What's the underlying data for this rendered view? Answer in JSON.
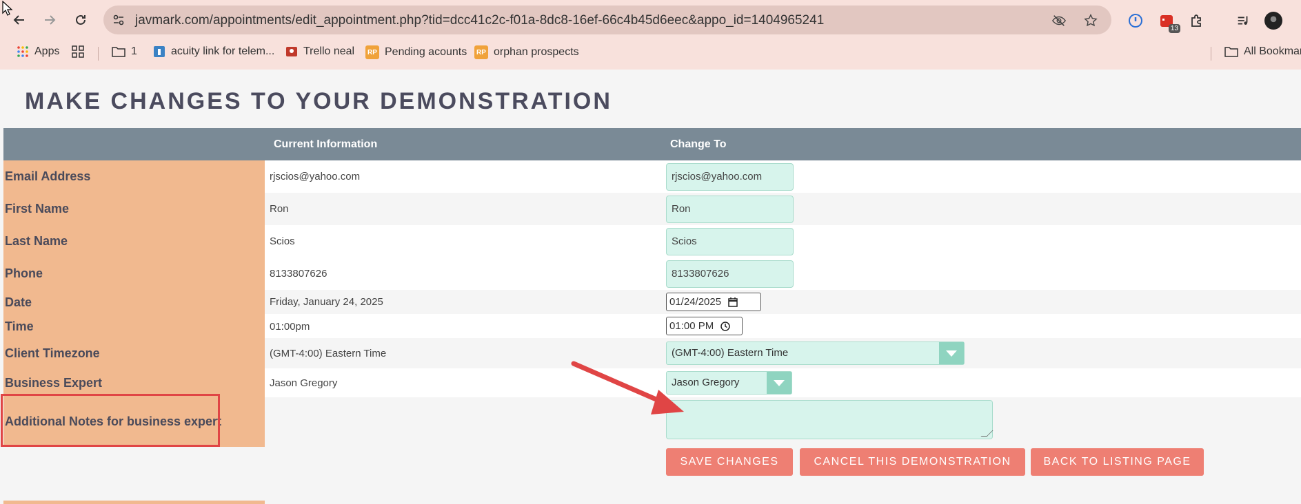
{
  "browser": {
    "url": "javmark.com/appointments/edit_appointment.php?tid=dcc41c2c-f01a-8dc8-16ef-66c4b45d6eec&appo_id=1404965241",
    "extension_badge": "13",
    "bookmarks": {
      "apps": "Apps",
      "folder_1": "1",
      "acuity": "acuity link for telem...",
      "trello": "Trello neal",
      "pending": "Pending acounts",
      "orphan": "orphan prospects",
      "all_bookmarks": "All Bookmar"
    },
    "rp_badge": "RP"
  },
  "page": {
    "title": "MAKE CHANGES TO YOUR DEMONSTRATION"
  },
  "table": {
    "headers": {
      "current": "Current Information",
      "change_to": "Change To"
    },
    "rows": {
      "email": {
        "label": "Email Address",
        "current": "rjscios@yahoo.com",
        "value": "rjscios@yahoo.com"
      },
      "first_name": {
        "label": "First Name",
        "current": "Ron",
        "value": "Ron"
      },
      "last_name": {
        "label": "Last Name",
        "current": "Scios",
        "value": "Scios"
      },
      "phone": {
        "label": "Phone",
        "current": "8133807626",
        "value": "8133807626"
      },
      "date": {
        "label": "Date",
        "current": "Friday, January 24, 2025",
        "value": "01/24/2025"
      },
      "time": {
        "label": "Time",
        "current": "01:00pm",
        "value": "01:00 PM"
      },
      "timezone": {
        "label": "Client Timezone",
        "current": "(GMT-4:00) Eastern Time",
        "value": "(GMT-4:00) Eastern Time"
      },
      "expert": {
        "label": "Business Expert",
        "current": "Jason Gregory",
        "value": "Jason Gregory"
      },
      "notes": {
        "label": "Additional Notes for business expert",
        "value": ""
      }
    }
  },
  "buttons": {
    "save": "SAVE CHANGES",
    "cancel": "CANCEL THIS DEMONSTRATION",
    "back": "BACK TO LISTING PAGE"
  },
  "colors": {
    "label_column": "#f1b98f",
    "header_bar": "#7a8a96",
    "input_bg": "#d7f4ec",
    "button": "#ee7f73",
    "annotation": "#e04545"
  }
}
